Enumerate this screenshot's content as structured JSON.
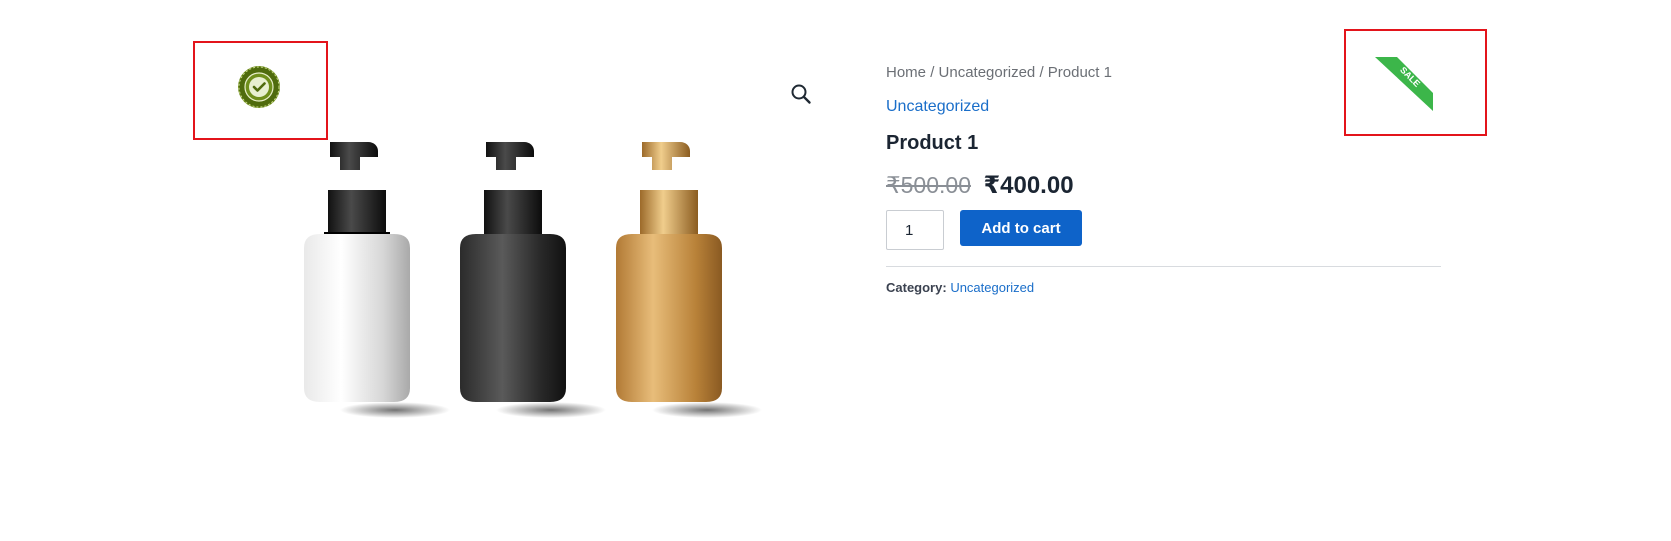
{
  "breadcrumb": {
    "items": [
      "Home",
      "Uncategorized",
      "Product 1"
    ],
    "separator": "/"
  },
  "product": {
    "category_link": "Uncategorized",
    "title": "Product 1",
    "price_old": "₹500.00",
    "price_new": "₹400.00",
    "quantity": "1",
    "add_to_cart_label": "Add to cart",
    "meta_label": "Category:",
    "meta_category": "Uncategorized"
  },
  "badges": {
    "approved_seal_icon": "approved-seal-icon",
    "sale_ribbon_text": "SALE",
    "sale_ribbon_color": "#3cb64a"
  },
  "gallery": {
    "zoom_icon": "magnifier-icon",
    "bottles": [
      "white",
      "black",
      "gold"
    ]
  },
  "colors": {
    "accent": "#0e63c9",
    "link": "#1a6ec9",
    "highlight": "#e3141b"
  }
}
